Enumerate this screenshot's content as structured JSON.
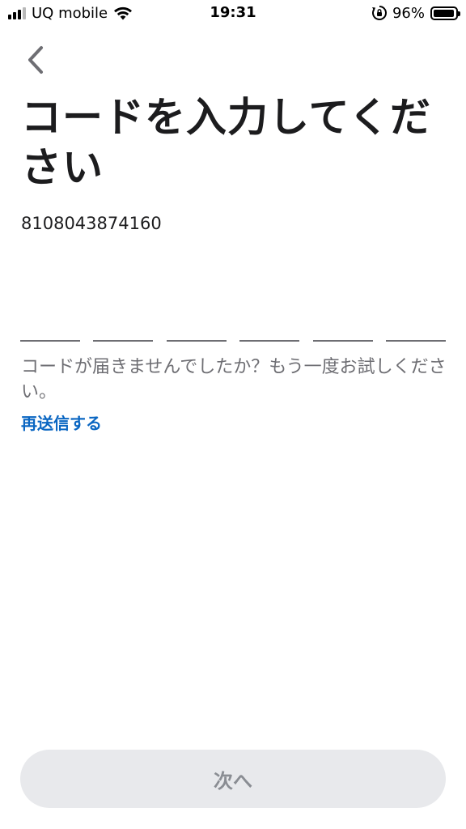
{
  "status_bar": {
    "carrier": "UQ mobile",
    "time": "19:31",
    "battery_percent": "96%",
    "battery_level": 0.96,
    "icons": [
      "signal-icon",
      "wifi-icon",
      "orientation-lock-icon",
      "battery-icon"
    ]
  },
  "header": {
    "back_icon": "chevron-left-icon",
    "title": "コードを入力してください"
  },
  "phone_number": "8108043874160",
  "code": {
    "digits": [
      "",
      "",
      "",
      "",
      "",
      ""
    ]
  },
  "help": {
    "text": "コードが届きませんでしたか？もう一度お試しください。",
    "resend_label": "再送信する"
  },
  "footer": {
    "next_label": "次へ",
    "next_enabled": false
  },
  "colors": {
    "link": "#0a66c2",
    "title": "#1c1c1e",
    "secondary_text": "#6e6e73",
    "button_disabled_bg": "#e8e9ec",
    "button_disabled_text": "#8a8d93"
  }
}
